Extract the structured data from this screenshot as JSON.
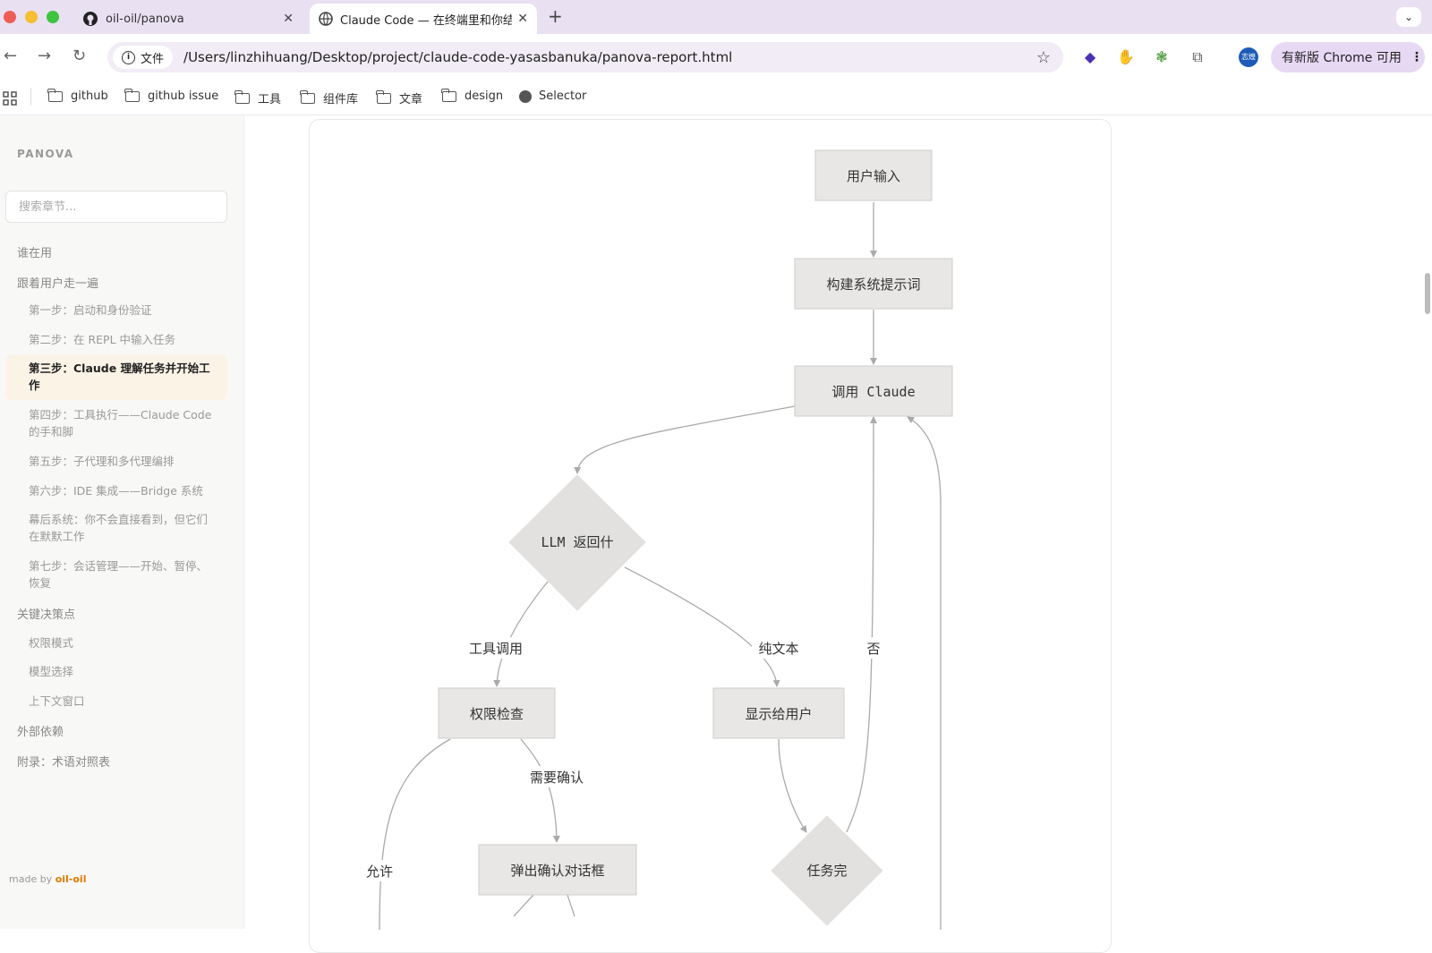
{
  "browser": {
    "tabs": [
      {
        "title": "oil-oil/panova",
        "icon": "github-icon"
      },
      {
        "title": "Claude Code — 在终端里和你结",
        "icon": "globe-icon"
      }
    ],
    "new_tab_label": "+",
    "omnibox": {
      "scheme_chip": "文件",
      "url": "/Users/linzhihuang/Desktop/project/claude-code-yasasbanuka/panova-report.html"
    },
    "avatar_text": "志煌",
    "update_label": "有新版 Chrome 可用",
    "bookmarks": [
      "github",
      "github issue",
      "工具",
      "组件库",
      "文章",
      "design",
      "Selector"
    ]
  },
  "sidebar": {
    "brand": "PANOVA",
    "search_placeholder": "搜索章节...",
    "items": [
      {
        "label": "谁在用",
        "level": 1
      },
      {
        "label": "跟着用户走一遍",
        "level": 1
      },
      {
        "label": "第一步：启动和身份验证",
        "level": 2
      },
      {
        "label": "第二步：在 REPL 中输入任务",
        "level": 2
      },
      {
        "label": "第三步：Claude 理解任务并开始工作",
        "level": 2,
        "active": true
      },
      {
        "label": "第四步：工具执行——Claude Code 的手和脚",
        "level": 2
      },
      {
        "label": "第五步：子代理和多代理编排",
        "level": 2
      },
      {
        "label": "第六步：IDE 集成——Bridge 系统",
        "level": 2
      },
      {
        "label": "幕后系统：你不会直接看到，但它们在默默工作",
        "level": 2
      },
      {
        "label": "第七步：会话管理——开始、暂停、恢复",
        "level": 2
      },
      {
        "label": "关键决策点",
        "level": 1
      },
      {
        "label": "权限模式",
        "level": 2
      },
      {
        "label": "模型选择",
        "level": 2
      },
      {
        "label": "上下文窗口",
        "level": 2
      },
      {
        "label": "外部依赖",
        "level": 1
      },
      {
        "label": "附录：术语对照表",
        "level": 1
      }
    ],
    "footer_prefix": "made by",
    "footer_author": "oil-oil"
  },
  "flowchart": {
    "nodes": {
      "user_input": "用户输入",
      "build_prompt": "构建系统提示词",
      "call_claude": "调用 Claude",
      "llm_returns": "LLM 返回什",
      "permission_check": "权限检查",
      "show_user": "显示给用户",
      "confirm_dialog": "弹出确认对话框",
      "task_done": "任务完"
    },
    "edge_labels": {
      "tool_call": "工具调用",
      "plain_text": "纯文本",
      "no": "否",
      "need_confirm": "需要确认",
      "allow": "允许"
    },
    "colors": {
      "node_fill": "#e8e7e5",
      "node_stroke": "#cfcdca",
      "edge": "#aaaaaa"
    }
  }
}
